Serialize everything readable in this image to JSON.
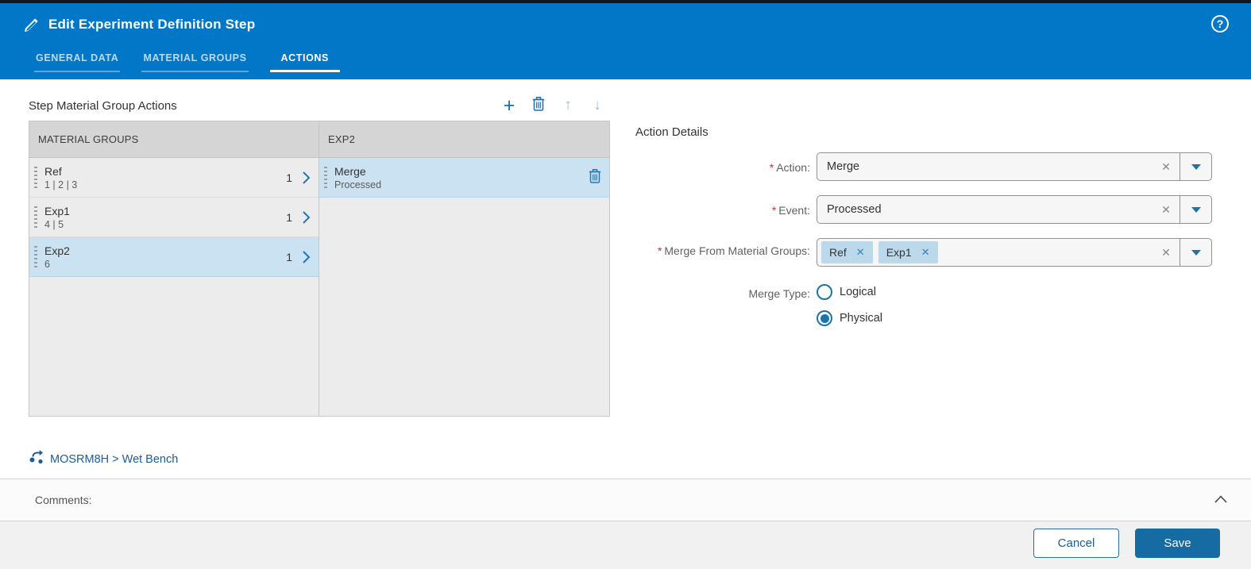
{
  "window": {
    "title": "Edit Experiment Definition Step"
  },
  "tabs": [
    {
      "label": "GENERAL DATA"
    },
    {
      "label": "MATERIAL GROUPS"
    },
    {
      "label": "ACTIONS"
    }
  ],
  "active_tab": "ACTIONS",
  "icons": {
    "add": "+",
    "move_up": "↑",
    "move_down": "↓",
    "clear": "✕",
    "chip_remove": "✕",
    "help": "?"
  },
  "left_panel": {
    "title": "Step Material Group Actions",
    "table": {
      "columns": [
        "MATERIAL GROUPS",
        "EXP2"
      ],
      "rows": [
        {
          "name": "Ref",
          "steps": "1 | 2 | 3",
          "count": "1",
          "selected": false
        },
        {
          "name": "Exp1",
          "steps": "4 | 5",
          "count": "1",
          "selected": false
        },
        {
          "name": "Exp2",
          "steps": "6",
          "count": "1",
          "selected": true
        }
      ],
      "action_cell": {
        "title": "Merge",
        "subtitle": "Processed",
        "selected": true
      }
    }
  },
  "right_panel": {
    "title": "Action Details",
    "fields": {
      "action": {
        "label": "Action:",
        "required": true,
        "value": "Merge"
      },
      "event": {
        "label": "Event:",
        "required": true,
        "value": "Processed"
      },
      "merge_from": {
        "label": "Merge From Material Groups:",
        "required": true,
        "chips": [
          "Ref",
          "Exp1"
        ]
      },
      "merge_type": {
        "label": "Merge Type:",
        "options": [
          {
            "label": "Logical",
            "selected": false
          },
          {
            "label": "Physical",
            "selected": true
          }
        ]
      }
    }
  },
  "breadcrumb": {
    "text": "MOSRM8H > Wet Bench"
  },
  "comments": {
    "label": "Comments:"
  },
  "footer": {
    "cancel_label": "Cancel",
    "save_label": "Save"
  },
  "colors": {
    "header_blue": "#0277c8",
    "accent_blue": "#1b6fae",
    "selection_blue": "#cbe2f2",
    "chip_blue": "#bcd9ec",
    "save_button": "#176ba3",
    "required_red": "#b23b34",
    "table_header_grey": "#d5d5d5",
    "row_grey": "#ececec"
  }
}
